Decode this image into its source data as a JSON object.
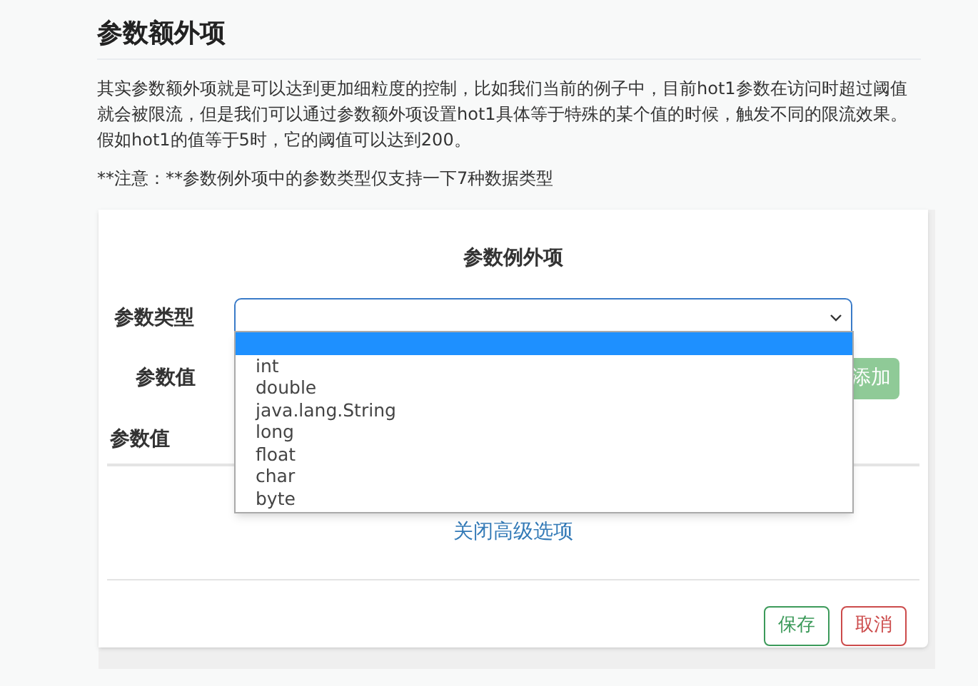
{
  "heading": "参数额外项",
  "paragraph": "其实参数额外项就是可以达到更加细粒度的控制，比如我们当前的例子中，目前hot1参数在访问时超过阈值就会被限流，但是我们可以通过参数额外项设置hot1具体等于特殊的某个值的时候，触发不同的限流效果。假如hot1的值等于5时，它的阈值可以达到200。",
  "note": "**注意：**参数例外项中的参数类型仅支持一下7种数据类型",
  "card": {
    "title": "参数例外项",
    "type_label": "参数类型",
    "value_label": "参数值",
    "add_button": "添加",
    "dropdown": [
      {
        "selected": true
      },
      {
        "label": "int",
        "selected": false
      },
      {
        "label": "double",
        "selected": false
      },
      {
        "label": "java.lang.String",
        "selected": false
      },
      {
        "label": "long",
        "selected": false
      },
      {
        "label": "float",
        "selected": false
      },
      {
        "label": "char",
        "selected": false
      },
      {
        "label": "byte",
        "selected": false
      }
    ],
    "table_header": "参数值",
    "toggle_link": "关闭高级选项",
    "buttons": [
      {
        "label": "保存",
        "kind": "save"
      },
      {
        "label": "取消",
        "kind": "cancel"
      }
    ]
  }
}
